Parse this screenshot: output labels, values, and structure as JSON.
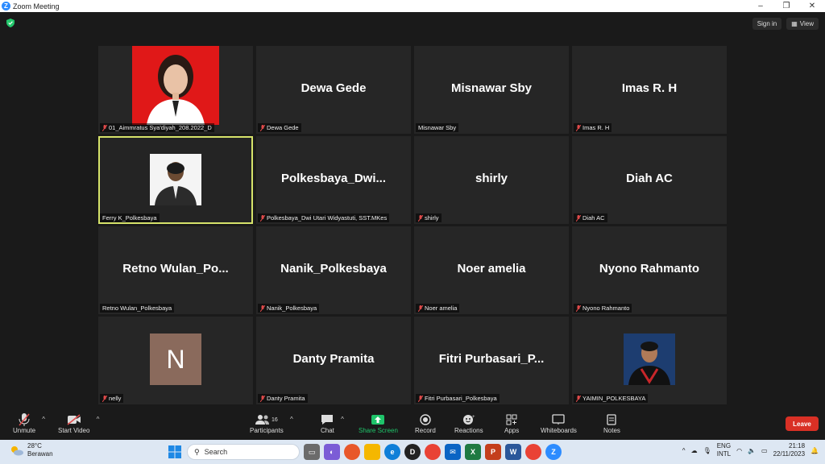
{
  "window": {
    "title": "Zoom Meeting"
  },
  "header": {
    "sign_in": "Sign in",
    "view": "View"
  },
  "tiles": [
    {
      "big": "",
      "label": "01_Aimmratus Sya'diyah_208.2022_D",
      "muted": true
    },
    {
      "big": "Dewa Gede",
      "label": "Dewa Gede",
      "muted": true
    },
    {
      "big": "Misnawar Sby",
      "label": "Misnawar Sby",
      "muted": false
    },
    {
      "big": "Imas R. H",
      "label": "Imas R. H",
      "muted": true
    },
    {
      "big": "",
      "label": "Ferry K_Polkesbaya",
      "muted": false
    },
    {
      "big": "Polkesbaya_Dwi...",
      "label": "Polkesbaya_Dwi Utari Widyastuti, SST.MKes",
      "muted": true
    },
    {
      "big": "shirly",
      "label": "shirly",
      "muted": true
    },
    {
      "big": "Diah AC",
      "label": "Diah AC",
      "muted": true
    },
    {
      "big": "Retno  Wulan_Po...",
      "label": "Retno Wulan_Polkesbaya",
      "muted": false
    },
    {
      "big": "Nanik_Polkesbaya",
      "label": "Nanik_Polkesbaya",
      "muted": true
    },
    {
      "big": "Noer amelia",
      "label": "Noer amelia",
      "muted": true
    },
    {
      "big": "Nyono Rahmanto",
      "label": "Nyono Rahmanto",
      "muted": true
    },
    {
      "big": "",
      "avatar": "N",
      "label": "nelly",
      "muted": true
    },
    {
      "big": "Danty Pramita",
      "label": "Danty Pramita",
      "muted": true
    },
    {
      "big": "Fitri  Purbasari_P...",
      "label": "Fitri Purbasari_Polkesbaya",
      "muted": true
    },
    {
      "big": "",
      "label": "YAIMIN_POLKESBAYA",
      "muted": true
    }
  ],
  "toolbar": {
    "unmute": "Unmute",
    "start_video": "Start Video",
    "participants": "Participants",
    "participants_count": "16",
    "chat": "Chat",
    "share_screen": "Share Screen",
    "record": "Record",
    "reactions": "Reactions",
    "apps": "Apps",
    "whiteboards": "Whiteboards",
    "notes": "Notes",
    "leave": "Leave"
  },
  "taskbar": {
    "temp": "28°C",
    "weather": "Berawan",
    "search": "Search",
    "lang1": "ENG",
    "lang2": "INTL",
    "time": "21:18",
    "date": "22/11/2023"
  },
  "colors": {
    "active_border": "#d6e36a",
    "leave": "#d93025",
    "share": "#1fc46a",
    "accent": "#2d8cff"
  }
}
